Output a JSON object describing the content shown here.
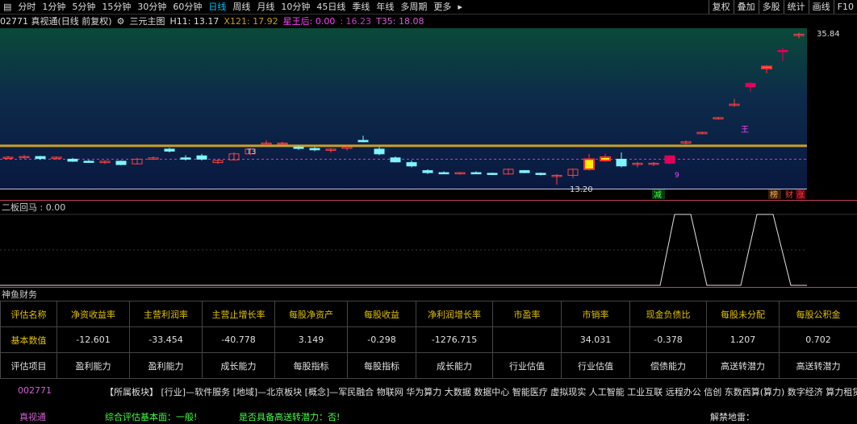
{
  "toolbar": {
    "icon": "grid-icon",
    "periods": [
      "分时",
      "1分钟",
      "5分钟",
      "15分钟",
      "30分钟",
      "60分钟",
      "日线",
      "周线",
      "月线",
      "10分钟",
      "45日线",
      "季线",
      "年线",
      "多周期",
      "更多"
    ],
    "active_period": "日线",
    "right_buttons": [
      "复权",
      "叠加",
      "多股",
      "统计",
      "画线",
      "F10"
    ]
  },
  "info": {
    "code_name": "02771 真视通(日线 前复权)",
    "indicator": "三元主图",
    "h11": "H11: 13.17",
    "x121": "X121: 17.92",
    "xingwang": "星王后: 0.00",
    "v1": ": 16.23",
    "t35": "T35: 18.08"
  },
  "colors": {
    "gold": "#c8a028",
    "cyan": "#7ef5ff",
    "red_up": "#ff4040",
    "magenta": "#e0005a",
    "yellow": "#ffee00"
  },
  "main_chart": {
    "ylim": [
      12.5,
      36.5
    ],
    "price_high_label": "35.84",
    "price_low_label": "13.20",
    "t3_label": "T3",
    "markers": {
      "jian": "减",
      "gao": "榜",
      "cai": "财",
      "zhang": "涨",
      "wang": "王",
      "nine": "9"
    },
    "gold_line": 19.0,
    "dashed_line": 17.0,
    "candles": [
      [
        17.2,
        17.5,
        17.0,
        17.3
      ],
      [
        17.3,
        17.6,
        17.1,
        17.4
      ],
      [
        17.4,
        17.5,
        16.9,
        17.1
      ],
      [
        17.1,
        17.4,
        16.9,
        17.3
      ],
      [
        17.0,
        17.2,
        16.6,
        16.7
      ],
      [
        16.7,
        16.9,
        16.5,
        16.6
      ],
      [
        16.5,
        16.8,
        16.3,
        16.7
      ],
      [
        16.7,
        16.8,
        16.1,
        16.2
      ],
      [
        16.3,
        17.2,
        16.2,
        17.0
      ],
      [
        17.0,
        17.4,
        16.9,
        17.2
      ],
      [
        18.5,
        18.7,
        18.0,
        18.2
      ],
      [
        17.2,
        17.6,
        16.8,
        17.0
      ],
      [
        17.5,
        17.8,
        16.8,
        17.0
      ],
      [
        16.5,
        17.0,
        16.3,
        16.8
      ],
      [
        16.9,
        18.0,
        16.8,
        17.8
      ],
      [
        17.8,
        18.6,
        17.6,
        18.5
      ],
      [
        19.2,
        19.8,
        19.0,
        19.4
      ],
      [
        19.3,
        19.6,
        19.1,
        19.4
      ],
      [
        18.8,
        19.0,
        18.4,
        18.6
      ],
      [
        18.6,
        18.8,
        18.2,
        18.4
      ],
      [
        18.4,
        18.6,
        18.0,
        18.5
      ],
      [
        18.6,
        19.0,
        18.3,
        18.8
      ],
      [
        19.8,
        20.5,
        19.5,
        19.6
      ],
      [
        18.5,
        18.8,
        17.6,
        17.8
      ],
      [
        17.2,
        17.4,
        16.5,
        16.6
      ],
      [
        16.5,
        16.8,
        15.8,
        16.0
      ],
      [
        15.3,
        15.5,
        14.8,
        15.0
      ],
      [
        15.0,
        15.2,
        14.8,
        14.9
      ],
      [
        14.9,
        15.1,
        14.7,
        15.0
      ],
      [
        15.0,
        15.2,
        14.8,
        14.9
      ],
      [
        14.9,
        15.0,
        14.7,
        14.8
      ],
      [
        14.8,
        15.6,
        14.7,
        15.5
      ],
      [
        15.3,
        15.4,
        14.9,
        15.0
      ],
      [
        14.9,
        15.0,
        14.6,
        14.8
      ],
      [
        14.6,
        14.8,
        13.2,
        14.6
      ],
      [
        14.6,
        15.6,
        14.2,
        15.5
      ],
      [
        15.5,
        17.8,
        15.3,
        17.0
      ],
      [
        17.3,
        17.8,
        16.6,
        16.8
      ],
      [
        17.0,
        18.0,
        15.8,
        16.0
      ],
      [
        16.2,
        16.6,
        15.8,
        16.4
      ],
      [
        16.3,
        16.6,
        16.0,
        16.4
      ],
      [
        16.4,
        17.6,
        16.2,
        17.5
      ],
      [
        19.4,
        19.8,
        19.2,
        19.6
      ],
      [
        20.8,
        21.1,
        20.7,
        21.0
      ],
      [
        23.0,
        23.3,
        22.9,
        23.2
      ],
      [
        25.0,
        26.0,
        24.8,
        25.2
      ],
      [
        27.8,
        28.5,
        27.0,
        28.3
      ],
      [
        30.5,
        31.0,
        29.8,
        30.8
      ],
      [
        33.0,
        33.6,
        31.6,
        33.2
      ],
      [
        35.4,
        35.84,
        35.0,
        35.6
      ]
    ],
    "special": {
      "36": "yellow-up",
      "37": "yellow-up",
      "41": "magenta-up",
      "46": "magenta-up",
      "47": "yellow-up",
      "48": "magenta-up"
    }
  },
  "sub_chart": {
    "title": "二板回马 : 0.00"
  },
  "finance": {
    "title": "神鱼财务",
    "headers": [
      "评估名称",
      "净资收益率",
      "主营利润率",
      "主营止增长率",
      "每股净资产",
      "每股收益",
      "净利润增长率",
      "市盈率",
      "市销率",
      "现金负债比",
      "每股未分配",
      "每股公积金"
    ],
    "values": [
      "基本数值",
      "-12.601",
      "-33.454",
      "-40.778",
      "3.149",
      "-0.298",
      "-1276.715",
      "",
      "34.031",
      "-0.378",
      "1.207",
      "0.702"
    ],
    "categories": [
      "评估项目",
      "盈利能力",
      "盈利能力",
      "成长能力",
      "每股指标",
      "每股指标",
      "成长能力",
      "行业估值",
      "行业估值",
      "偿债能力",
      "高送转潜力",
      "高送转潜力"
    ]
  },
  "bottom": {
    "code": "002771",
    "sector": "【所属板块】 [行业]—软件服务 [地域]—北京板块 [概念]—军民融合 物联网 华为算力 大数据 数据中心 智能医疗 虚拟现实 人工智能 工业互联 远程办公 信创 东数西算(算力) 数字经济 算力租赁",
    "name": "真视通",
    "eval": "综合评估基本面：一般!",
    "transfer": "是否具备高送转潜力：否!",
    "lift": "解禁地雷："
  }
}
